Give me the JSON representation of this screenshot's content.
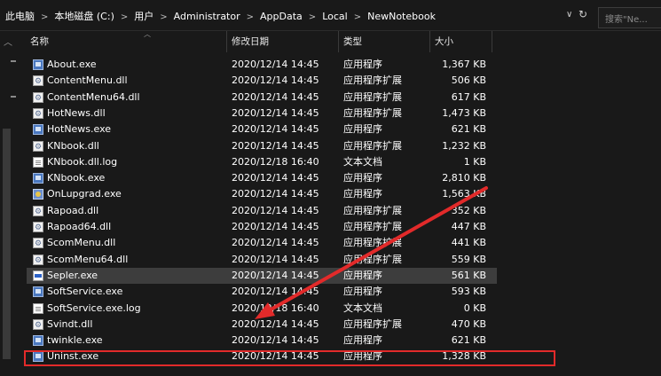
{
  "address": {
    "crumbs": [
      "此电脑",
      "本地磁盘 (C:)",
      "用户",
      "Administrator",
      "AppData",
      "Local",
      "NewNotebook"
    ],
    "separator": ">",
    "dropdown_glyph": "∨",
    "refresh_glyph": "↻"
  },
  "search": {
    "placeholder": "搜索\"Ne..."
  },
  "columns": {
    "name": "名称",
    "date": "修改日期",
    "type": "类型",
    "size": "大小"
  },
  "files": [
    {
      "name": "About.exe",
      "date": "2020/12/14 14:45",
      "type": "应用程序",
      "size": "1,367 KB",
      "icon": "exe-icon"
    },
    {
      "name": "ContentMenu.dll",
      "date": "2020/12/14 14:45",
      "type": "应用程序扩展",
      "size": "506 KB",
      "icon": "dll-icon"
    },
    {
      "name": "ContentMenu64.dll",
      "date": "2020/12/14 14:45",
      "type": "应用程序扩展",
      "size": "617 KB",
      "icon": "dll-icon"
    },
    {
      "name": "HotNews.dll",
      "date": "2020/12/14 14:45",
      "type": "应用程序扩展",
      "size": "1,473 KB",
      "icon": "dll-icon"
    },
    {
      "name": "HotNews.exe",
      "date": "2020/12/14 14:45",
      "type": "应用程序",
      "size": "621 KB",
      "icon": "exe-icon"
    },
    {
      "name": "KNbook.dll",
      "date": "2020/12/14 14:45",
      "type": "应用程序扩展",
      "size": "1,232 KB",
      "icon": "dll-icon"
    },
    {
      "name": "KNbook.dll.log",
      "date": "2020/12/18 16:40",
      "type": "文本文档",
      "size": "1 KB",
      "icon": "text-file-icon"
    },
    {
      "name": "KNbook.exe",
      "date": "2020/12/14 14:45",
      "type": "应用程序",
      "size": "2,810 KB",
      "icon": "exe-icon"
    },
    {
      "name": "OnLupgrad.exe",
      "date": "2020/12/14 14:45",
      "type": "应用程序",
      "size": "1,563 KB",
      "icon": "upgrade-exe-icon"
    },
    {
      "name": "Rapoad.dll",
      "date": "2020/12/14 14:45",
      "type": "应用程序扩展",
      "size": "352 KB",
      "icon": "dll-icon"
    },
    {
      "name": "Rapoad64.dll",
      "date": "2020/12/14 14:45",
      "type": "应用程序扩展",
      "size": "447 KB",
      "icon": "dll-icon"
    },
    {
      "name": "ScomMenu.dll",
      "date": "2020/12/14 14:45",
      "type": "应用程序扩展",
      "size": "441 KB",
      "icon": "dll-icon"
    },
    {
      "name": "ScomMenu64.dll",
      "date": "2020/12/14 14:45",
      "type": "应用程序扩展",
      "size": "559 KB",
      "icon": "dll-icon"
    },
    {
      "name": "Sepler.exe",
      "date": "2020/12/14 14:45",
      "type": "应用程序",
      "size": "561 KB",
      "icon": "sepler-exe-icon",
      "selected": true
    },
    {
      "name": "SoftService.exe",
      "date": "2020/12/14 14:45",
      "type": "应用程序",
      "size": "593 KB",
      "icon": "exe-icon"
    },
    {
      "name": "SoftService.exe.log",
      "date": "2020/12/18 16:40",
      "type": "文本文档",
      "size": "0 KB",
      "icon": "text-file-icon"
    },
    {
      "name": "Svindt.dll",
      "date": "2020/12/14 14:45",
      "type": "应用程序扩展",
      "size": "470 KB",
      "icon": "dll-icon"
    },
    {
      "name": "twinkle.exe",
      "date": "2020/12/14 14:45",
      "type": "应用程序",
      "size": "621 KB",
      "icon": "exe-icon"
    },
    {
      "name": "Uninst.exe",
      "date": "2020/12/14 14:45",
      "type": "应用程序",
      "size": "1,328 KB",
      "icon": "uninstall-exe-icon",
      "highlighted": true
    }
  ],
  "colors": {
    "background": "#191919",
    "selected_row": "#3d3d3d",
    "annotation": "#e22a2a"
  }
}
